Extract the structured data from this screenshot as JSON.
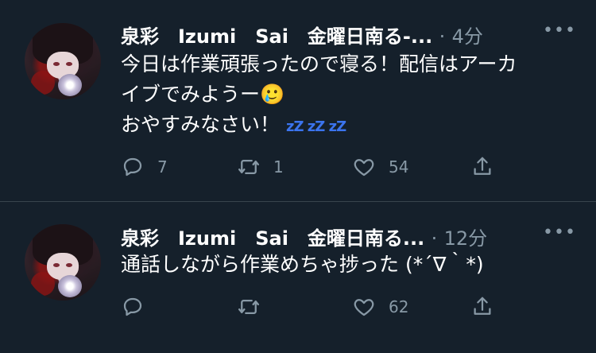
{
  "tweets": [
    {
      "display_name": "泉彩　Izumi　Sai　金曜日南る-...",
      "separator": "·",
      "time": "4分",
      "more_label": "•••",
      "text_lines": [
        "今日は作業頑張ったので寝る！配信はアーカ",
        "イブでみようー🥲",
        "おやすみなさい！"
      ],
      "zzz": [
        "zZ",
        "zZ",
        "zZ"
      ],
      "reply_count": "7",
      "retweet_count": "1",
      "like_count": "54"
    },
    {
      "display_name": "泉彩　Izumi　Sai　金曜日南る...",
      "separator": "·",
      "time": "12分",
      "more_label": "•••",
      "text_lines": [
        "通話しながら作業めちゃ捗った (*´∇｀*)"
      ],
      "reply_count": "",
      "retweet_count": "",
      "like_count": "62"
    }
  ],
  "icons": {
    "reply": "reply-icon",
    "retweet": "retweet-icon",
    "like": "heart-icon",
    "share": "share-icon"
  },
  "colors": {
    "background": "#15202b",
    "text": "#ffffff",
    "muted": "#8899a6",
    "divider": "#38444d",
    "zzz": "#3b74ee"
  }
}
